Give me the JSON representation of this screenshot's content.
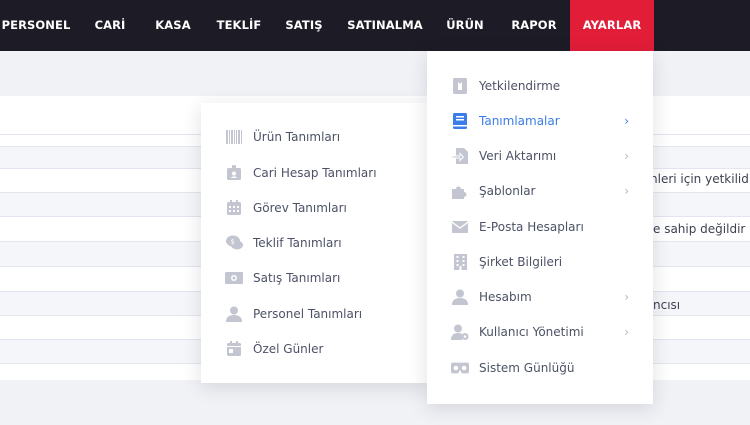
{
  "nav": {
    "items": [
      {
        "label": "PERSONEL"
      },
      {
        "label": "CARİ"
      },
      {
        "label": "KASA"
      },
      {
        "label": "TEKLİF"
      },
      {
        "label": "SATIŞ"
      },
      {
        "label": "SATINALMA"
      },
      {
        "label": "ÜRÜN"
      },
      {
        "label": "RAPOR"
      },
      {
        "label": "AYARLAR",
        "active": true
      }
    ],
    "active_color": "#e21d38",
    "bar_color": "#1c1b26"
  },
  "background": {
    "row_texts": [
      "nleri için yetkilidir",
      "e sahip değildir",
      "ncısı"
    ]
  },
  "settings_menu": {
    "items": [
      {
        "label": "Yetkilendirme",
        "icon": "id-badge-icon"
      },
      {
        "label": "Tanımlamalar",
        "icon": "book-icon",
        "submenu": true,
        "highlighted": true
      },
      {
        "label": "Veri Aktarımı",
        "icon": "file-import-icon",
        "submenu": true
      },
      {
        "label": "Şablonlar",
        "icon": "puzzle-icon",
        "submenu": true
      },
      {
        "label": "E-Posta Hesapları",
        "icon": "envelope-icon"
      },
      {
        "label": "Şirket Bilgileri",
        "icon": "building-icon"
      },
      {
        "label": "Hesabım",
        "icon": "user-icon",
        "submenu": true
      },
      {
        "label": "Kullanıcı Yönetimi",
        "icon": "user-cog-icon",
        "submenu": true
      },
      {
        "label": "Sistem Günlüğü",
        "icon": "vr-cardboard-icon"
      }
    ],
    "chevron": "›",
    "highlight_color": "#3b7de8"
  },
  "definitions_menu": {
    "items": [
      {
        "label": "Ürün Tanımları",
        "icon": "barcode-icon"
      },
      {
        "label": "Cari Hesap Tanımları",
        "icon": "id-card-icon"
      },
      {
        "label": "Görev Tanımları",
        "icon": "calendar-icon"
      },
      {
        "label": "Teklif Tanımları",
        "icon": "comments-dollar-icon"
      },
      {
        "label": "Satış Tanımları",
        "icon": "money-bill-icon"
      },
      {
        "label": "Personel Tanımları",
        "icon": "user-tie-icon"
      },
      {
        "label": "Özel Günler",
        "icon": "calendar-day-icon"
      }
    ]
  }
}
